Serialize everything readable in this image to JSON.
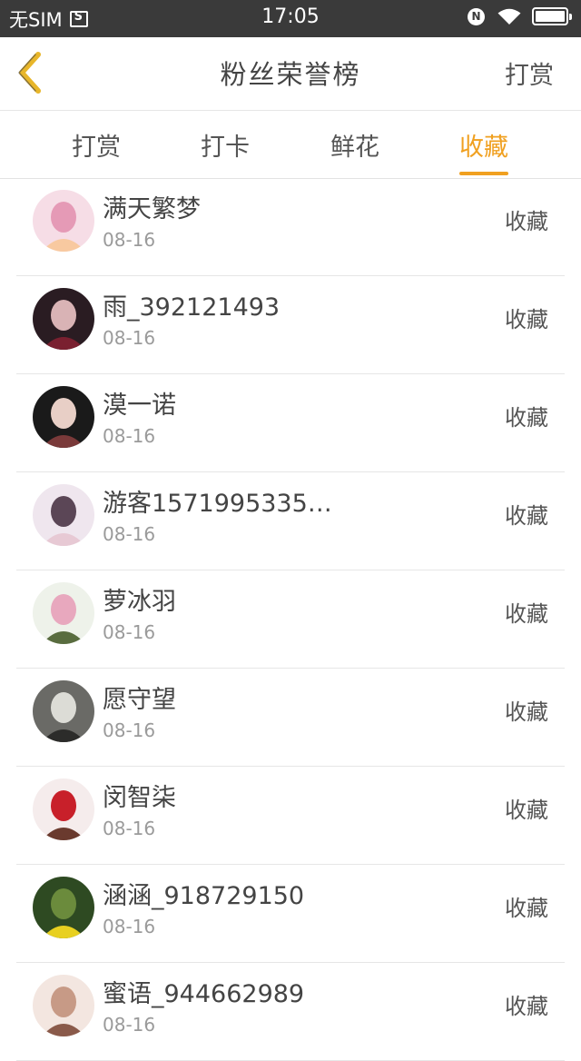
{
  "status_bar": {
    "carrier": "无SIM",
    "time": "17:05",
    "nfc_label": "N",
    "icons": [
      "sim-icon",
      "nfc-icon",
      "wifi-icon",
      "battery-icon"
    ]
  },
  "nav": {
    "back_icon": "chevron-left-icon",
    "title": "粉丝荣誉榜",
    "right_label": "打赏",
    "accent_color": "#f0a020"
  },
  "tabs": [
    {
      "label": "打赏",
      "active": false
    },
    {
      "label": "打卡",
      "active": false
    },
    {
      "label": "鲜花",
      "active": false
    },
    {
      "label": "收藏",
      "active": true
    }
  ],
  "fans": [
    {
      "name": "满天繁梦",
      "date": "08-16",
      "action": "收藏",
      "avatar_colors": [
        "#f6dde6",
        "#e59ab6",
        "#f8c9a0"
      ]
    },
    {
      "name": "雨_392121493",
      "date": "08-16",
      "action": "收藏",
      "avatar_colors": [
        "#2a1c22",
        "#d9b3b5",
        "#7a2030"
      ]
    },
    {
      "name": "漠一诺",
      "date": "08-16",
      "action": "收藏",
      "avatar_colors": [
        "#1a1a1a",
        "#e8cfc6",
        "#7a3a3a"
      ]
    },
    {
      "name": "游客1571995335…",
      "date": "08-16",
      "action": "收藏",
      "avatar_colors": [
        "#efe6ee",
        "#5b4656",
        "#e7c9d4"
      ]
    },
    {
      "name": "萝冰羽",
      "date": "08-16",
      "action": "收藏",
      "avatar_colors": [
        "#eef2ea",
        "#e8a8be",
        "#596c3f"
      ]
    },
    {
      "name": "愿守望",
      "date": "08-16",
      "action": "收藏",
      "avatar_colors": [
        "#6a6a66",
        "#dcdcd6",
        "#2c2c2a"
      ]
    },
    {
      "name": "闵智柒",
      "date": "08-16",
      "action": "收藏",
      "avatar_colors": [
        "#f5ecec",
        "#c8202a",
        "#6a3a2e"
      ]
    },
    {
      "name": "涵涵_918729150",
      "date": "08-16",
      "action": "收藏",
      "avatar_colors": [
        "#2e4a22",
        "#6b8b3c",
        "#e8d020"
      ]
    },
    {
      "name": "蜜语_944662989",
      "date": "08-16",
      "action": "收藏",
      "avatar_colors": [
        "#f3e6e0",
        "#c79a86",
        "#8a5a4a"
      ]
    }
  ]
}
